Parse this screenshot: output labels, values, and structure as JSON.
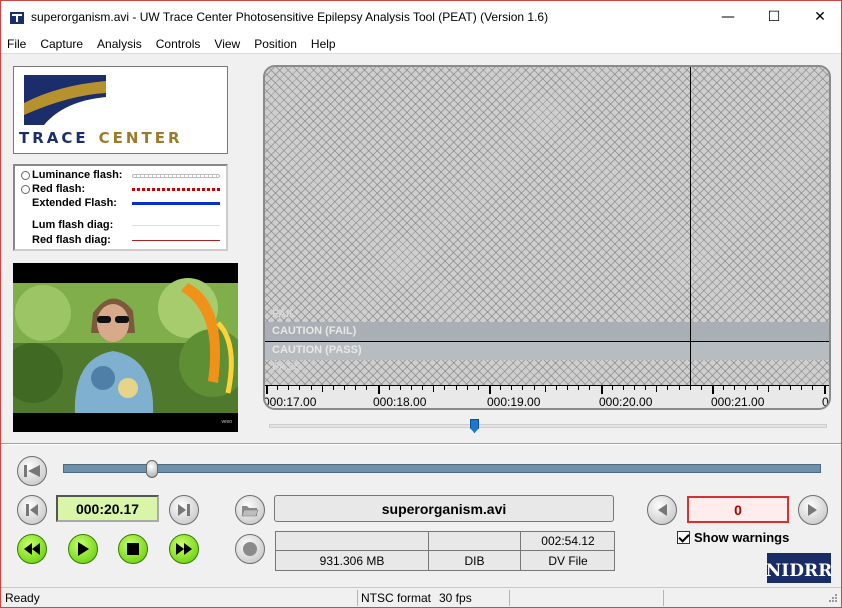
{
  "window": {
    "title": "superorganism.avi - UW Trace Center Photosensitive Epilepsy Analysis Tool (PEAT) (Version 1.6)",
    "minimize_glyph": "—",
    "maximize_glyph": "☐",
    "close_glyph": "✕"
  },
  "menu": [
    "File",
    "Capture",
    "Analysis",
    "Controls",
    "View",
    "Position",
    "Help"
  ],
  "logo": {
    "word1": "TRACE",
    "word2": "CENTER"
  },
  "legend": {
    "items": [
      {
        "label": "Luminance flash:",
        "style": "dotted",
        "color": "#ffffff"
      },
      {
        "label": "Red flash:",
        "style": "dashed",
        "color": "#cc0000"
      },
      {
        "label": "Extended Flash:",
        "style": "solid",
        "color": "#0a2ed0"
      },
      {
        "label": "Lum flash diag:",
        "style": "thin",
        "color": "#dddddd"
      },
      {
        "label": "Red flash diag:",
        "style": "thin",
        "color": "#b02020"
      }
    ]
  },
  "video": {
    "watermark": "vevo"
  },
  "graph": {
    "zones": [
      "FAIL",
      "CAUTION (FAIL)",
      "CAUTION (PASS)",
      "PASS"
    ],
    "ticks": [
      "000:17.00",
      "000:18.00",
      "000:19.00",
      "000:20.00",
      "000:21.00",
      "0"
    ]
  },
  "player": {
    "current_time": "000:20.17",
    "position_fraction": 0.117
  },
  "file": {
    "name": "superorganism.avi",
    "duration": "002:54.12",
    "size": "931.306 MB",
    "codec": "DIB",
    "type": "DV File"
  },
  "warnings": {
    "count": "0",
    "show_label": "Show warnings"
  },
  "branding": {
    "nidrr": "NIDRR"
  },
  "status": {
    "state": "Ready",
    "format": "NTSC format",
    "fps": "30 fps"
  }
}
